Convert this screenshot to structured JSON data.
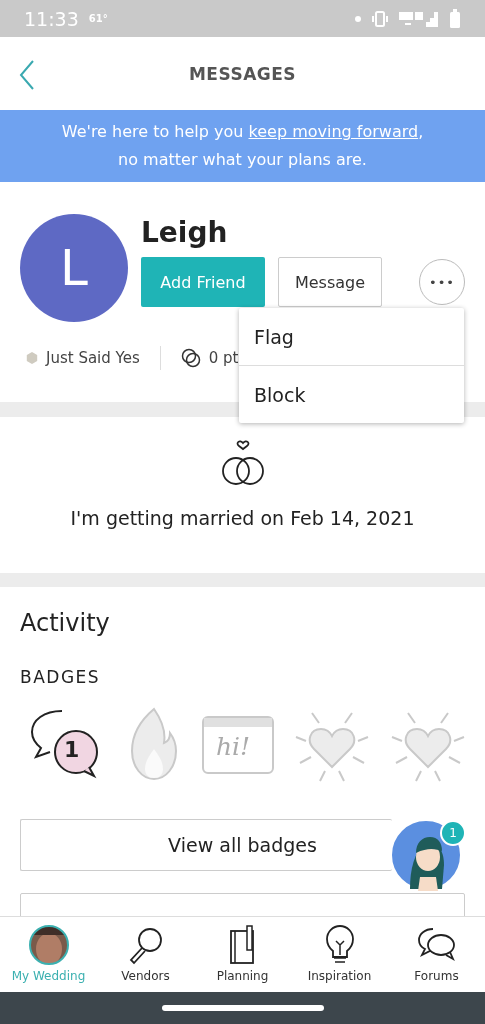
{
  "status_bar": {
    "time": "11:33",
    "temperature": "61°"
  },
  "header": {
    "title": "MESSAGES"
  },
  "banner": {
    "before": "We're here to help you ",
    "link": "keep moving forward",
    "after": ", no matter what your plans are."
  },
  "profile": {
    "initial": "L",
    "name": "Leigh",
    "add_friend": "Add Friend",
    "message": "Message",
    "more": "•••",
    "status": "Just Said Yes",
    "points": "0 pt"
  },
  "menu": {
    "items": [
      {
        "label": "Flag"
      },
      {
        "label": "Block"
      }
    ]
  },
  "wedding": {
    "text": "I'm getting married on Feb 14, 2021"
  },
  "activity": {
    "title": "Activity",
    "badges_heading": "BADGES",
    "badges": [
      {
        "kind": "chat",
        "earned": true,
        "count": "1"
      },
      {
        "kind": "flame",
        "earned": false
      },
      {
        "kind": "hi",
        "earned": false,
        "text": "hi!"
      },
      {
        "kind": "heart",
        "earned": false
      },
      {
        "kind": "heart",
        "earned": false
      }
    ],
    "view_all": "View all badges",
    "assistant_count": "1"
  },
  "tabs": [
    {
      "label": "My Wedding",
      "kind": "avatar",
      "selected": true
    },
    {
      "label": "Vendors",
      "kind": "search",
      "selected": false
    },
    {
      "label": "Planning",
      "kind": "notebook",
      "selected": false
    },
    {
      "label": "Inspiration",
      "kind": "bulb",
      "selected": false
    },
    {
      "label": "Forums",
      "kind": "forums",
      "selected": false
    }
  ]
}
